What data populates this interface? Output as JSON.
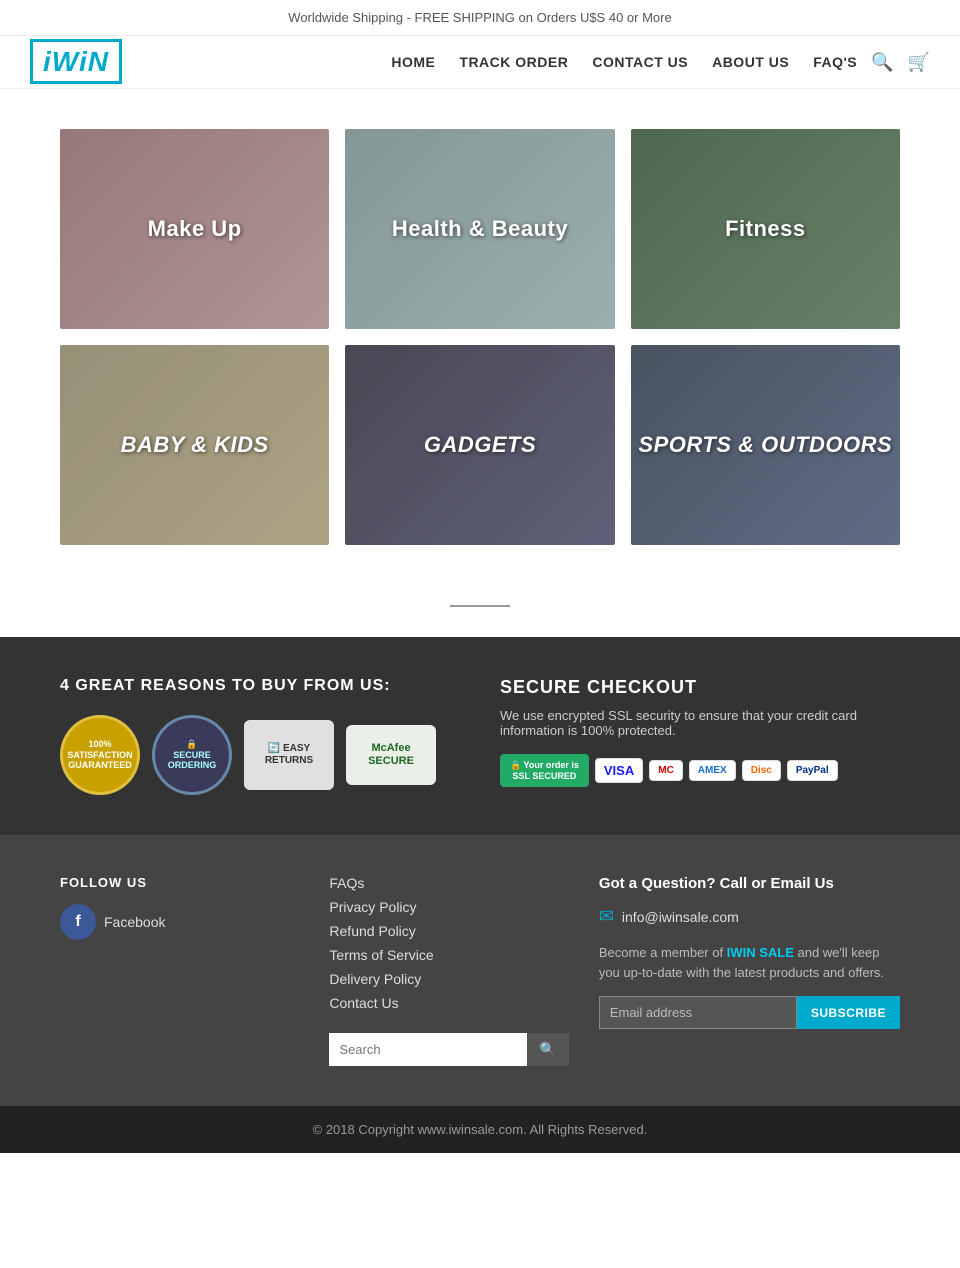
{
  "topBanner": {
    "text": "Worldwide Shipping - FREE SHIPPING on Orders U$S 40 or More"
  },
  "header": {
    "logo": "iWiN",
    "nav": [
      {
        "label": "HOME",
        "id": "home"
      },
      {
        "label": "TRACK ORDER",
        "id": "track-order"
      },
      {
        "label": "CONTACT US",
        "id": "contact-us"
      },
      {
        "label": "ABOUT US",
        "id": "about-us"
      },
      {
        "label": "FAQ'S",
        "id": "faqs"
      }
    ],
    "searchPlaceholder": "Search",
    "cartLabel": "Cart"
  },
  "categories": [
    {
      "label": "Make Up",
      "colorClass": "cat-makeup"
    },
    {
      "label": "Health & Beauty",
      "colorClass": "cat-health"
    },
    {
      "label": "Fitness",
      "colorClass": "cat-fitness"
    },
    {
      "label": "BABY & KIDS",
      "colorClass": "cat-baby"
    },
    {
      "label": "GADGETS",
      "colorClass": "cat-gadgets"
    },
    {
      "label": "SPORTS & OUTDOORS",
      "colorClass": "cat-sports"
    }
  ],
  "trustSection": {
    "leftTitle": "4 GREAT REASONS TO BUY FROM US:",
    "badges": [
      {
        "label": "100% SATISFACTION GUARANTEED",
        "type": "satisfaction"
      },
      {
        "label": "SECURE ORDERING",
        "type": "secure"
      },
      {
        "label": "EASY RETURNS",
        "type": "returns"
      },
      {
        "label": "McAfee SECURE",
        "type": "mcafee"
      }
    ],
    "rightTitle": "SECURE CHECKOUT",
    "rightText": "We use encrypted SSL security to ensure that your credit card information is 100% protected.",
    "paymentMethods": [
      "SSL SECURED",
      "VISA",
      "MasterCard",
      "AMEX",
      "Discover",
      "PayPal"
    ]
  },
  "footer": {
    "followTitle": "FOLLOW US",
    "socialItems": [
      {
        "label": "Facebook",
        "icon": "f",
        "type": "facebook"
      }
    ],
    "links": [
      {
        "label": "FAQs",
        "href": "#"
      },
      {
        "label": "Privacy Policy",
        "href": "#"
      },
      {
        "label": "Refund Policy",
        "href": "#"
      },
      {
        "label": "Terms of Service",
        "href": "#"
      },
      {
        "label": "Delivery Policy",
        "href": "#"
      },
      {
        "label": "Contact Us",
        "href": "#"
      }
    ],
    "searchPlaceholder": "Search",
    "contactTitle": "Got a Question? Call or Email Us",
    "email": "info@iwinsale.com",
    "memberText1": "Become a member of ",
    "memberBrand": "IWIN SALE",
    "memberText2": " and we'll keep you up-to-date with the latest products and offers.",
    "emailPlaceholder": "Email address",
    "subscribeLabel": "SUBSCRIBE"
  },
  "copyright": {
    "text": "© 2018 Copyright www.iwinsale.com. All Rights Reserved."
  }
}
